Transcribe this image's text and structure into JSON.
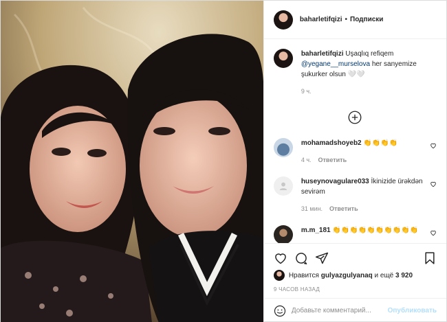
{
  "header": {
    "username": "baharletifqizi",
    "separator": "•",
    "follow_label": "Подписки"
  },
  "caption": {
    "username": "baharletifqizi",
    "text_before": "Uşaqlıq refiqem",
    "mention": "@yegane__murselova",
    "text_after": "her sanyemize şukurker olsun 🤍🤍",
    "time": "9 ч."
  },
  "comments": [
    {
      "username": "mohamadshoyeb2",
      "text": "👏👏👏👏",
      "time": "4 ч.",
      "reply": "Ответить"
    },
    {
      "username": "huseynovagulare033",
      "text": "İkinizide ürəkdən sevirəm",
      "time": "31 мин.",
      "reply": "Ответить"
    },
    {
      "username": "m.m_181",
      "text": "👏👏👏👏👏👏👏👏👏👏",
      "time": "",
      "reply": ""
    }
  ],
  "icons": [
    "heart-icon",
    "comment-icon",
    "share-icon",
    "bookmark-icon",
    "plus-circle-icon",
    "emoji-icon"
  ],
  "likes": {
    "prefix": "Нравится",
    "user": "gulyazgulyanaq",
    "middle": "и ещё",
    "count": "3 920"
  },
  "timestamp": "9 ЧАСОВ НАЗАД",
  "add_comment": {
    "placeholder": "Добавьте комментарий...",
    "publish_label": "Опубликовать"
  },
  "colors": {
    "link": "#00376b",
    "publish_disabled": "#b2dffc",
    "muted": "#8e8e8e"
  }
}
